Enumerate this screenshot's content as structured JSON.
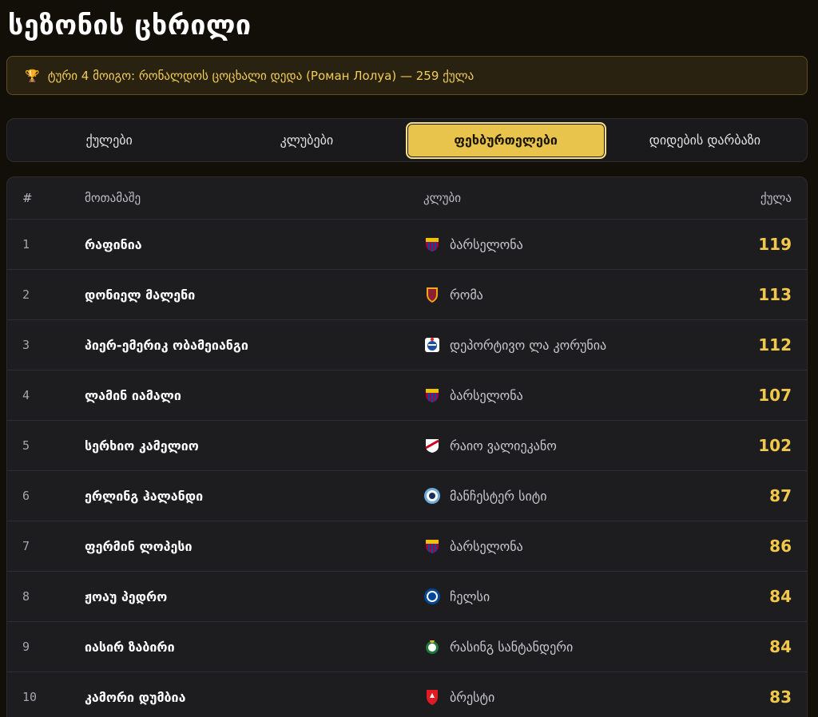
{
  "page": {
    "title": "სეზონის ცხრილი"
  },
  "banner": {
    "icon": "trophy-icon",
    "text": "ტური 4 მოიგო: რონალდოს ცოცხალი დედა (Роман Лолуа) — 259 ქულა"
  },
  "tabs": [
    {
      "label": "ქულები",
      "active": false
    },
    {
      "label": "კლუბები",
      "active": false
    },
    {
      "label": "ფეხბურთელები",
      "active": true
    },
    {
      "label": "დიდების დარბაზი",
      "active": false
    }
  ],
  "table": {
    "headers": {
      "rank": "#",
      "player": "მოთამაშე",
      "club": "კლუბი",
      "points": "ქულა"
    },
    "rows": [
      {
        "rank": "1",
        "player": "რაფინია",
        "club": "ბარსელონა",
        "crest": "barcelona",
        "points": "119"
      },
      {
        "rank": "2",
        "player": "დონიელ მალენი",
        "club": "რომა",
        "crest": "roma",
        "points": "113"
      },
      {
        "rank": "3",
        "player": "პიერ-ემერიკ ობამეიანგი",
        "club": "დეპორტივო ლა კორუნია",
        "crest": "deportivo",
        "points": "112"
      },
      {
        "rank": "4",
        "player": "ლამინ იამალი",
        "club": "ბარსელონა",
        "crest": "barcelona",
        "points": "107"
      },
      {
        "rank": "5",
        "player": "სერხიო კამელიო",
        "club": "რაიო ვალიეკანო",
        "crest": "rayo",
        "points": "102"
      },
      {
        "rank": "6",
        "player": "ერლინგ ჰალანდი",
        "club": "მანჩესტერ სიტი",
        "crest": "mancity",
        "points": "87"
      },
      {
        "rank": "7",
        "player": "ფერმინ ლოპესი",
        "club": "ბარსელონა",
        "crest": "barcelona",
        "points": "86"
      },
      {
        "rank": "8",
        "player": "ჟოაუ პედრო",
        "club": "ჩელსი",
        "crest": "chelsea",
        "points": "84"
      },
      {
        "rank": "9",
        "player": "იასირ ზაბირი",
        "club": "რასინგ სანტანდერი",
        "crest": "racing",
        "points": "84"
      },
      {
        "rank": "10",
        "player": "კამორი დუმბია",
        "club": "ბრესტი",
        "crest": "brest",
        "points": "83"
      }
    ]
  },
  "colors": {
    "background": "#120f09",
    "accent": "#e9c44c",
    "points": "#f1c84b",
    "banner_text": "#f1cd5a"
  }
}
